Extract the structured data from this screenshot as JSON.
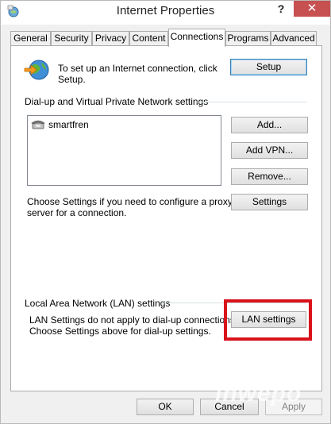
{
  "window": {
    "title": "Internet Properties"
  },
  "titlebar": {
    "help_label": "?",
    "close_label": "✕"
  },
  "tabs": [
    {
      "label": "General"
    },
    {
      "label": "Security"
    },
    {
      "label": "Privacy"
    },
    {
      "label": "Content"
    },
    {
      "label": "Connections",
      "active": true
    },
    {
      "label": "Programs"
    },
    {
      "label": "Advanced"
    }
  ],
  "setup": {
    "text_line1": "To set up an Internet connection, click",
    "text_line2": "Setup.",
    "button_label": "Setup"
  },
  "dialup": {
    "group_label": "Dial-up and Virtual Private Network settings",
    "connections": [
      {
        "name": "smartfren"
      }
    ],
    "add_label": "Add...",
    "add_vpn_label": "Add VPN...",
    "remove_label": "Remove...",
    "settings_label": "Settings",
    "proxy_text_line1": "Choose Settings if you need to configure a proxy",
    "proxy_text_line2": "server for a connection."
  },
  "lan": {
    "group_label": "Local Area Network (LAN) settings",
    "text_line1": "LAN Settings do not apply to dial-up connections.",
    "text_line2": "Choose Settings above for dial-up settings.",
    "button_label": "LAN settings"
  },
  "footer": {
    "ok_label": "OK",
    "cancel_label": "Cancel",
    "apply_label": "Apply"
  },
  "watermark": "inwepo",
  "colors": {
    "highlight": "#d9121b",
    "close_button": "#c75050"
  }
}
